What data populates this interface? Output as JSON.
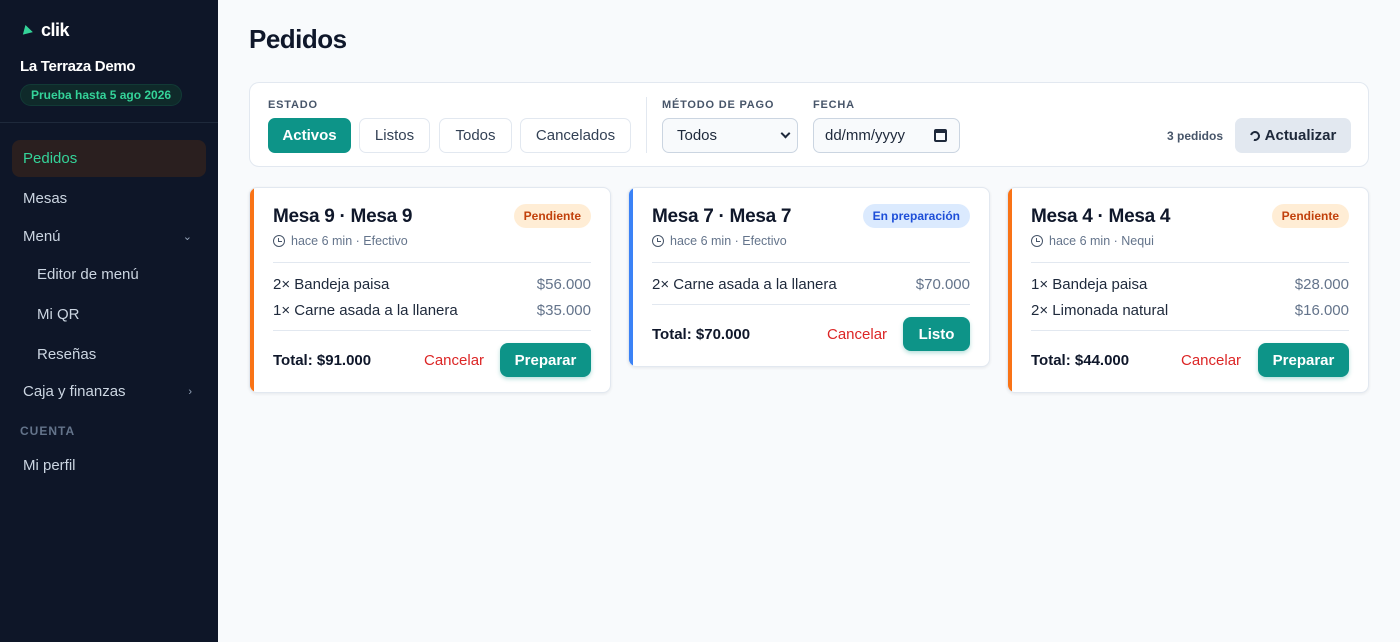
{
  "brand": {
    "name": "clik",
    "icon": "brand-play-icon",
    "accent": "#34d399"
  },
  "restaurant": {
    "name": "La Terraza Demo",
    "trial": "Prueba hasta 5 ago 2026"
  },
  "sidebar": {
    "items": [
      {
        "label": "Pedidos",
        "active": true
      },
      {
        "label": "Mesas"
      },
      {
        "label": "Menú",
        "chevron": "chevron-down-icon"
      },
      {
        "label": "Editor de menú"
      },
      {
        "label": "Mi QR"
      },
      {
        "label": "Reseñas"
      },
      {
        "label": "Caja y finanzas",
        "chevron": "chevron-right-icon"
      }
    ],
    "section_label": "CUENTA",
    "account_items": [
      {
        "label": "Mi perfil"
      }
    ]
  },
  "page": {
    "title": "Pedidos"
  },
  "filters": {
    "estado_label": "ESTADO",
    "estado_options": [
      "Activos",
      "Listos",
      "Todos",
      "Cancelados"
    ],
    "estado_selected": "Activos",
    "metodo_label": "MÉTODO DE PAGO",
    "metodo_value": "Todos",
    "fecha_label": "FECHA",
    "fecha_placeholder": "dd/mm/yyyy",
    "count": "3 pedidos",
    "refresh_label": "Actualizar"
  },
  "orders": [
    {
      "title": "Mesa 9 · Mesa 9",
      "status": "Pendiente",
      "status_color": "#c2410c",
      "accent": "#f97316",
      "meta": "hace 6 min · Efectivo",
      "items": [
        {
          "name": "2× Bandeja paisa",
          "price": "$56.000"
        },
        {
          "name": "1× Carne asada a la llanera",
          "price": "$35.000"
        }
      ],
      "total": "Total: $91.000",
      "cancel": "Cancelar",
      "action": "Preparar"
    },
    {
      "title": "Mesa 7 · Mesa 7",
      "status": "En preparación",
      "status_color": "#1d4ed8",
      "accent": "#3b82f6",
      "meta": "hace 6 min · Efectivo",
      "items": [
        {
          "name": "2× Carne asada a la llanera",
          "price": "$70.000"
        }
      ],
      "total": "Total: $70.000",
      "cancel": "Cancelar",
      "action": "Listo"
    },
    {
      "title": "Mesa 4 · Mesa 4",
      "status": "Pendiente",
      "status_color": "#c2410c",
      "accent": "#f97316",
      "meta": "hace 6 min · Nequi",
      "items": [
        {
          "name": "1× Bandeja paisa",
          "price": "$28.000"
        },
        {
          "name": "2× Limonada natural",
          "price": "$16.000"
        }
      ],
      "total": "Total: $44.000",
      "cancel": "Cancelar",
      "action": "Preparar"
    }
  ]
}
